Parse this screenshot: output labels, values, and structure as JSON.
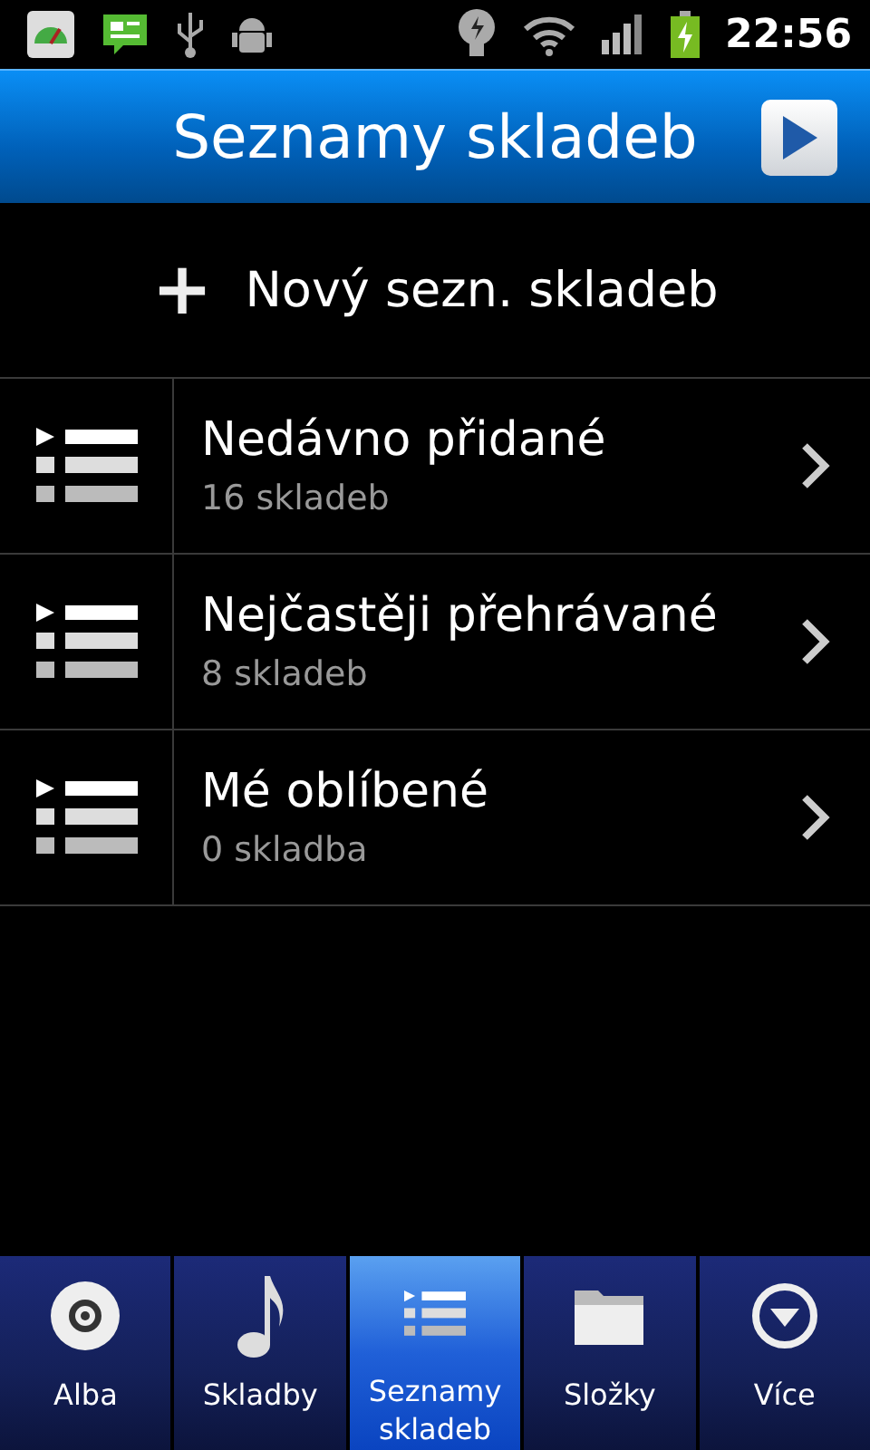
{
  "status_bar": {
    "time": "22:56"
  },
  "header": {
    "title": "Seznamy skladeb"
  },
  "new_playlist": {
    "icon": "+",
    "label": "Nový sezn. skladeb"
  },
  "playlists": [
    {
      "name": "Nedávno přidané",
      "count": "16 skladeb"
    },
    {
      "name": "Nejčastěji přehrávané",
      "count": "8 skladeb"
    },
    {
      "name": "Mé oblíbené",
      "count": "0 skladba"
    }
  ],
  "tabs": [
    {
      "kind": "disc",
      "label": "Alba",
      "selected": false
    },
    {
      "kind": "note",
      "label": "Skladby",
      "selected": false
    },
    {
      "kind": "list",
      "label": "Seznamy skladeb",
      "selected": true
    },
    {
      "kind": "folder",
      "label": "Složky",
      "selected": false
    },
    {
      "kind": "more",
      "label": "Více",
      "selected": false
    }
  ]
}
